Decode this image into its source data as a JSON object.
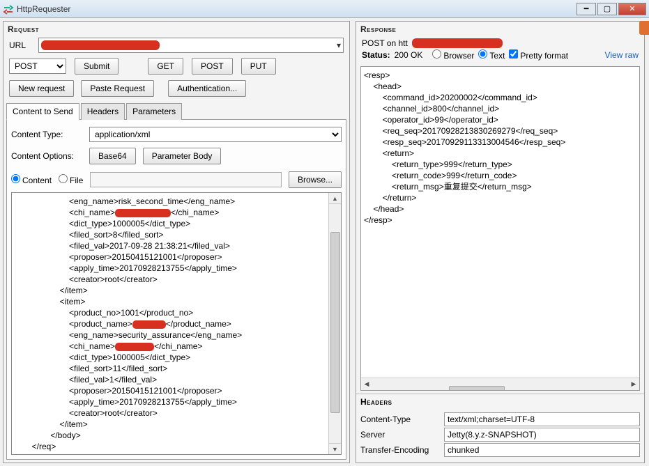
{
  "window": {
    "title": "HttpRequester"
  },
  "request": {
    "panel_title": "Request",
    "url_label": "URL",
    "method_selected": "POST",
    "buttons": {
      "submit": "Submit",
      "get": "GET",
      "post": "POST",
      "put": "PUT",
      "new_request": "New request",
      "paste_request": "Paste Request",
      "authentication": "Authentication..."
    },
    "tabs": {
      "content": "Content to Send",
      "headers": "Headers",
      "parameters": "Parameters"
    },
    "content_type_label": "Content Type:",
    "content_type_value": "application/xml",
    "content_options_label": "Content Options:",
    "base64_btn": "Base64",
    "parameter_body_btn": "Parameter Body",
    "radio_content": "Content",
    "radio_file": "File",
    "browse_btn": "Browse...",
    "body_lines": [
      {
        "indent": 4,
        "pre": "<eng_name>risk_second_time</eng_name>"
      },
      {
        "indent": 4,
        "pre": "<chi_name>",
        "redact_w": 80,
        "post": "</chi_name>"
      },
      {
        "indent": 4,
        "pre": "<dict_type>1000005</dict_type>"
      },
      {
        "indent": 4,
        "pre": "<filed_sort>8</filed_sort>"
      },
      {
        "indent": 4,
        "pre": "<filed_val>2017-09-28 21:38:21</filed_val>"
      },
      {
        "indent": 4,
        "pre": "<proposer>20150415121001</proposer>"
      },
      {
        "indent": 4,
        "pre": "<apply_time>20170928213755</apply_time>"
      },
      {
        "indent": 4,
        "pre": "<creator>root</creator>"
      },
      {
        "indent": 3,
        "pre": "</item>"
      },
      {
        "indent": 3,
        "pre": "<item>"
      },
      {
        "indent": 4,
        "pre": "<product_no>1001</product_no>"
      },
      {
        "indent": 4,
        "pre": "<product_name>",
        "redact_w": 48,
        "post": "</product_name>"
      },
      {
        "indent": 4,
        "pre": "<eng_name>security_assurance</eng_name>"
      },
      {
        "indent": 4,
        "pre": "<chi_name>",
        "redact_w": 56,
        "post": "</chi_name>"
      },
      {
        "indent": 4,
        "pre": "<dict_type>1000005</dict_type>"
      },
      {
        "indent": 4,
        "pre": "<filed_sort>11</filed_sort>"
      },
      {
        "indent": 4,
        "pre": "<filed_val>1</filed_val>"
      },
      {
        "indent": 4,
        "pre": "<proposer>20150415121001</proposer>"
      },
      {
        "indent": 4,
        "pre": "<apply_time>20170928213755</apply_time>"
      },
      {
        "indent": 4,
        "pre": "<creator>root</creator>"
      },
      {
        "indent": 3,
        "pre": "</item>"
      },
      {
        "indent": 2,
        "pre": "</body>"
      },
      {
        "indent": 0,
        "pre": "</req>"
      }
    ]
  },
  "response": {
    "panel_title": "Response",
    "post_on": "POST on htt",
    "status_label": "Status:",
    "status_value": "200 OK",
    "radio_browser": "Browser",
    "radio_text": "Text",
    "pretty_format": "Pretty format",
    "view_raw": "View raw",
    "body_text": "<resp>\n    <head>\n        <command_id>20200002</command_id>\n        <channel_id>800</channel_id>\n        <operator_id>99</operator_id>\n        <req_seq>20170928213830269279</req_seq>\n        <resp_seq>20170929113313004546</resp_seq>\n        <return>\n            <return_type>999</return_type>\n            <return_code>999</return_code>\n            <return_msg>重复提交</return_msg>\n        </return>\n    </head>\n</resp>",
    "headers_title": "Headers",
    "headers": [
      {
        "key": "Content-Type",
        "val": "text/xml;charset=UTF-8"
      },
      {
        "key": "Server",
        "val": "Jetty(8.y.z-SNAPSHOT)"
      },
      {
        "key": "Transfer-Encoding",
        "val": "chunked"
      }
    ]
  }
}
